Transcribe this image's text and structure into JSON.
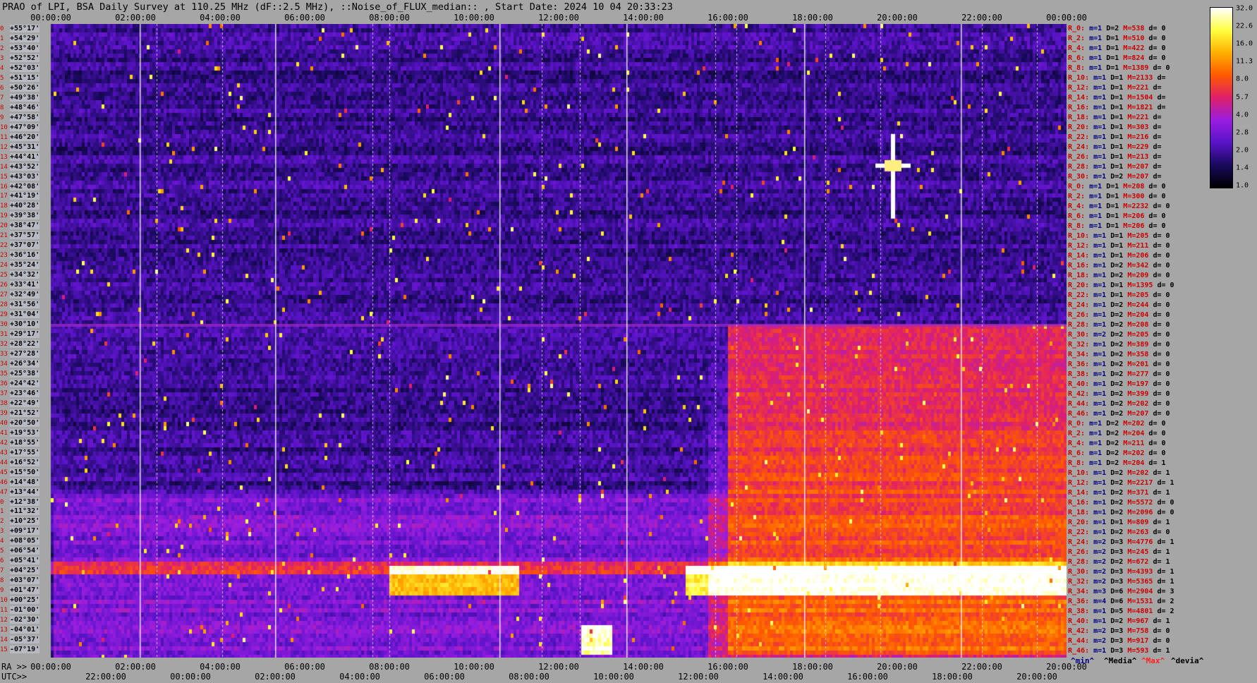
{
  "title": "PRAO of LPI, BSA Daily Survey at 110.25 MHz (dF::2.5 MHz), ::Noise_of_FLUX_median:: , Start Date: 2024 10 04 20:33:23",
  "top_ticks": [
    "00:00:00",
    "02:00:00",
    "04:00:00",
    "06:00:00",
    "08:00:00",
    "10:00:00",
    "12:00:00",
    "14:00:00",
    "16:00:00",
    "18:00:00",
    "20:00:00",
    "22:00:00",
    "00:00:00"
  ],
  "ra_label": "RA >>",
  "ra_ticks": [
    "00:00:00",
    "02:00:00",
    "04:00:00",
    "06:00:00",
    "08:00:00",
    "10:00:00",
    "12:00:00",
    "14:00:00",
    "16:00:00",
    "18:00:00",
    "20:00:00",
    "22:00:00",
    "20:00:00"
  ],
  "utc_label": "UTC>>",
  "utc_ticks": [
    "22:00:00",
    "00:00:00",
    "02:00:00",
    "04:00:00",
    "06:00:00",
    "08:00:00",
    "10:00:00",
    "12:00:00",
    "14:00:00",
    "16:00:00",
    "18:00:00",
    "20:00:00"
  ],
  "declinations": [
    "+55°17'",
    "+54°29'",
    "+53°40'",
    "+52°52'",
    "+52°03'",
    "+51°15'",
    "+50°26'",
    "+49°38'",
    "+48°46'",
    "+47°58'",
    "+47°09'",
    "+46°20'",
    "+45°31'",
    "+44°41'",
    "+43°52'",
    "+43°03'",
    "+42°08'",
    "+41°19'",
    "+40°28'",
    "+39°38'",
    "+38°47'",
    "+37°57'",
    "+37°07'",
    "+36°16'",
    "+35°24'",
    "+34°32'",
    "+33°41'",
    "+32°49'",
    "+31°56'",
    "+31°04'",
    "+30°10'",
    "+29°17'",
    "+28°22'",
    "+27°28'",
    "+26°34'",
    "+25°38'",
    "+24°42'",
    "+23°46'",
    "+22°49'",
    "+21°52'",
    "+20°50'",
    "+19°53'",
    "+18°55'",
    "+17°55'",
    "+16°52'",
    "+15°50'",
    "+14°48'",
    "+13°44'",
    "+12°38'",
    "+11°32'",
    "+10°25'",
    "+09°17'",
    "+08°05'",
    "+06°54'",
    "+05°41'",
    "+04°25'",
    "+03°07'",
    "+01°47'",
    "+00°25'",
    "-01°00'",
    "-02°30'",
    "-04°01'",
    "-05°37'",
    "-07°19'"
  ],
  "row_indices": [
    "0",
    "1",
    "2",
    "3",
    "4",
    "5",
    "6",
    "7",
    "8",
    "9",
    "10",
    "11",
    "12",
    "13",
    "14",
    "15",
    "16",
    "17",
    "18",
    "19",
    "20",
    "21",
    "22",
    "23",
    "24",
    "25",
    "26",
    "27",
    "28",
    "29",
    "30",
    "31",
    "32",
    "33",
    "34",
    "35",
    "36",
    "37",
    "38",
    "39",
    "40",
    "41",
    "42",
    "43",
    "44",
    "45",
    "46",
    "47",
    "0",
    "1",
    "2",
    "3",
    "4",
    "5",
    "6",
    "7",
    "8",
    "9",
    "10",
    "11",
    "12",
    "13",
    "14",
    "15"
  ],
  "right_stats": [
    {
      "r": "R_0:",
      "m": "m=1",
      "D": "D=2",
      "M": "M=538",
      "d": "d= 0"
    },
    {
      "r": "R_2:",
      "m": "m=1",
      "D": "D=1",
      "M": "M=510",
      "d": "d= 0"
    },
    {
      "r": "R_4:",
      "m": "m=1",
      "D": "D=1",
      "M": "M=422",
      "d": "d= 0"
    },
    {
      "r": "R_6:",
      "m": "m=1",
      "D": "D=1",
      "M": "M=824",
      "d": "d= 0"
    },
    {
      "r": "R_8:",
      "m": "m=1",
      "D": "D=1",
      "M": "M=1389",
      "d": "d= 0"
    },
    {
      "r": "R_10:",
      "m": "m=1",
      "D": "D=1",
      "M": "M=2133",
      "d": "d="
    },
    {
      "r": "R_12:",
      "m": "m=1",
      "D": "D=1",
      "M": "M=221",
      "d": "d="
    },
    {
      "r": "R_14:",
      "m": "m=1",
      "D": "D=1",
      "M": "M=1504",
      "d": "d="
    },
    {
      "r": "R_16:",
      "m": "m=1",
      "D": "D=1",
      "M": "M=1821",
      "d": "d="
    },
    {
      "r": "R_18:",
      "m": "m=1",
      "D": "D=1",
      "M": "M=221",
      "d": "d="
    },
    {
      "r": "R_20:",
      "m": "m=1",
      "D": "D=1",
      "M": "M=303",
      "d": "d="
    },
    {
      "r": "R_22:",
      "m": "m=1",
      "D": "D=1",
      "M": "M=216",
      "d": "d="
    },
    {
      "r": "R_24:",
      "m": "m=1",
      "D": "D=1",
      "M": "M=229",
      "d": "d="
    },
    {
      "r": "R_26:",
      "m": "m=1",
      "D": "D=1",
      "M": "M=213",
      "d": "d="
    },
    {
      "r": "R_28:",
      "m": "m=1",
      "D": "D=1",
      "M": "M=207",
      "d": "d="
    },
    {
      "r": "R_30:",
      "m": "m=1",
      "D": "D=2",
      "M": "M=207",
      "d": "d="
    },
    {
      "r": "R_0:",
      "m": "m=1",
      "D": "D=1",
      "M": "M=208",
      "d": "d= 0"
    },
    {
      "r": "R_2:",
      "m": "m=1",
      "D": "D=1",
      "M": "M=300",
      "d": "d= 0"
    },
    {
      "r": "R_4:",
      "m": "m=1",
      "D": "D=1",
      "M": "M=2232",
      "d": "d= 0"
    },
    {
      "r": "R_6:",
      "m": "m=1",
      "D": "D=1",
      "M": "M=206",
      "d": "d= 0"
    },
    {
      "r": "R_8:",
      "m": "m=1",
      "D": "D=1",
      "M": "M=206",
      "d": "d= 0"
    },
    {
      "r": "R_10:",
      "m": "m=1",
      "D": "D=1",
      "M": "M=205",
      "d": "d= 0"
    },
    {
      "r": "R_12:",
      "m": "m=1",
      "D": "D=1",
      "M": "M=211",
      "d": "d= 0"
    },
    {
      "r": "R_14:",
      "m": "m=1",
      "D": "D=1",
      "M": "M=206",
      "d": "d= 0"
    },
    {
      "r": "R_16:",
      "m": "m=1",
      "D": "D=2",
      "M": "M=342",
      "d": "d= 0"
    },
    {
      "r": "R_18:",
      "m": "m=1",
      "D": "D=2",
      "M": "M=209",
      "d": "d= 0"
    },
    {
      "r": "R_20:",
      "m": "m=1",
      "D": "D=1",
      "M": "M=1395",
      "d": "d= 0"
    },
    {
      "r": "R_22:",
      "m": "m=1",
      "D": "D=1",
      "M": "M=205",
      "d": "d= 0"
    },
    {
      "r": "R_24:",
      "m": "m=1",
      "D": "D=2",
      "M": "M=244",
      "d": "d= 0"
    },
    {
      "r": "R_26:",
      "m": "m=1",
      "D": "D=2",
      "M": "M=204",
      "d": "d= 0"
    },
    {
      "r": "R_28:",
      "m": "m=1",
      "D": "D=2",
      "M": "M=208",
      "d": "d= 0"
    },
    {
      "r": "R_30:",
      "m": "m=2",
      "D": "D=2",
      "M": "M=205",
      "d": "d= 0"
    },
    {
      "r": "R_32:",
      "m": "m=1",
      "D": "D=2",
      "M": "M=389",
      "d": "d= 0"
    },
    {
      "r": "R_34:",
      "m": "m=1",
      "D": "D=2",
      "M": "M=358",
      "d": "d= 0"
    },
    {
      "r": "R_36:",
      "m": "m=1",
      "D": "D=2",
      "M": "M=201",
      "d": "d= 0"
    },
    {
      "r": "R_38:",
      "m": "m=1",
      "D": "D=2",
      "M": "M=277",
      "d": "d= 0"
    },
    {
      "r": "R_40:",
      "m": "m=1",
      "D": "D=2",
      "M": "M=197",
      "d": "d= 0"
    },
    {
      "r": "R_42:",
      "m": "m=1",
      "D": "D=2",
      "M": "M=399",
      "d": "d= 0"
    },
    {
      "r": "R_44:",
      "m": "m=1",
      "D": "D=2",
      "M": "M=202",
      "d": "d= 0"
    },
    {
      "r": "R_46:",
      "m": "m=1",
      "D": "D=2",
      "M": "M=207",
      "d": "d= 0"
    },
    {
      "r": "R_0:",
      "m": "m=1",
      "D": "D=2",
      "M": "M=202",
      "d": "d= 0"
    },
    {
      "r": "R_2:",
      "m": "m=1",
      "D": "D=2",
      "M": "M=204",
      "d": "d= 0"
    },
    {
      "r": "R_4:",
      "m": "m=1",
      "D": "D=2",
      "M": "M=211",
      "d": "d= 0"
    },
    {
      "r": "R_6:",
      "m": "m=1",
      "D": "D=2",
      "M": "M=202",
      "d": "d= 0"
    },
    {
      "r": "R_8:",
      "m": "m=1",
      "D": "D=2",
      "M": "M=204",
      "d": "d= 1"
    },
    {
      "r": "R_10:",
      "m": "m=1",
      "D": "D=2",
      "M": "M=202",
      "d": "d= 1"
    },
    {
      "r": "R_12:",
      "m": "m=1",
      "D": "D=2",
      "M": "M=2217",
      "d": "d= 1"
    },
    {
      "r": "R_14:",
      "m": "m=1",
      "D": "D=2",
      "M": "M=371",
      "d": "d= 1"
    },
    {
      "r": "R_16:",
      "m": "m=1",
      "D": "D=2",
      "M": "M=5572",
      "d": "d= 0"
    },
    {
      "r": "R_18:",
      "m": "m=1",
      "D": "D=2",
      "M": "M=2096",
      "d": "d= 0"
    },
    {
      "r": "R_20:",
      "m": "m=1",
      "D": "D=1",
      "M": "M=809",
      "d": "d= 1"
    },
    {
      "r": "R_22:",
      "m": "m=1",
      "D": "D=2",
      "M": "M=263",
      "d": "d= 0"
    },
    {
      "r": "R_24:",
      "m": "m=2",
      "D": "D=3",
      "M": "M=4776",
      "d": "d= 1"
    },
    {
      "r": "R_26:",
      "m": "m=2",
      "D": "D=3",
      "M": "M=245",
      "d": "d= 1"
    },
    {
      "r": "R_28:",
      "m": "m=2",
      "D": "D=2",
      "M": "M=672",
      "d": "d= 1"
    },
    {
      "r": "R_30:",
      "m": "m=2",
      "D": "D=3",
      "M": "M=4393",
      "d": "d= 1"
    },
    {
      "r": "R_32:",
      "m": "m=2",
      "D": "D=3",
      "M": "M=5365",
      "d": "d= 1"
    },
    {
      "r": "R_34:",
      "m": "m=3",
      "D": "D=6",
      "M": "M=2904",
      "d": "d= 3"
    },
    {
      "r": "R_36:",
      "m": "m=4",
      "D": "D=6",
      "M": "M=1531",
      "d": "d= 2"
    },
    {
      "r": "R_38:",
      "m": "m=1",
      "D": "D=5",
      "M": "M=4801",
      "d": "d= 2"
    },
    {
      "r": "R_40:",
      "m": "m=1",
      "D": "D=2",
      "M": "M=967",
      "d": "d= 1"
    },
    {
      "r": "R_42:",
      "m": "m=2",
      "D": "D=3",
      "M": "M=758",
      "d": "d= 0"
    },
    {
      "r": "R_44:",
      "m": "m=2",
      "D": "D=3",
      "M": "M=917",
      "d": "d= 0"
    },
    {
      "r": "R_46:",
      "m": "m=1",
      "D": "D=3",
      "M": "M=593",
      "d": "d= 1"
    }
  ],
  "legend": {
    "min": "^min^",
    "median": "^Media^",
    "max": "^Max^",
    "devia": "^devia^"
  },
  "colorbar": {
    "ticks": [
      "32.0",
      "22.6",
      "16.0",
      "11.3",
      "8.0",
      "5.7",
      "4.0",
      "2.8",
      "2.0",
      "1.4",
      "1.0"
    ]
  },
  "chart_data": {
    "type": "heatmap",
    "title": "PRAO of LPI, BSA Daily Survey at 110.25 MHz (dF::2.5 MHz), ::Noise_of_FLUX_median:: , Start Date: 2024 10 04 20:33:23",
    "x_axis": "RA / UTC time, 00:00:00 to 24:00:00",
    "y_axis": "Declination, +55°17' to -07°19'",
    "color_scale": "log, 1.0 to 32.0",
    "colors": [
      "#000000",
      "#1a0a5e",
      "#5a14c8",
      "#9a1ee0",
      "#e0206a",
      "#ff5a00",
      "#ffb000",
      "#ffff40",
      "#ffffff"
    ],
    "regions": [
      {
        "desc": "dark quiet sky",
        "x": [
          0,
          24
        ],
        "y": [
          9,
          55
        ],
        "value": 1.6
      },
      {
        "desc": "bright band",
        "x": [
          8,
          11
        ],
        "y": [
          -1,
          2
        ],
        "value": 16
      },
      {
        "desc": "bright band",
        "x": [
          15,
          24
        ],
        "y": [
          -1,
          2
        ],
        "value": 22.6
      },
      {
        "desc": "elevated region",
        "x": [
          16,
          24
        ],
        "y": [
          -7,
          26
        ],
        "value": 5.7
      },
      {
        "desc": "bright burst",
        "x": [
          12.5,
          13.2
        ],
        "y": [
          -7,
          -4
        ],
        "value": 32
      },
      {
        "desc": "point source",
        "x": [
          19.9,
          19.9
        ],
        "y": [
          41,
          41
        ],
        "value": 32
      }
    ]
  }
}
